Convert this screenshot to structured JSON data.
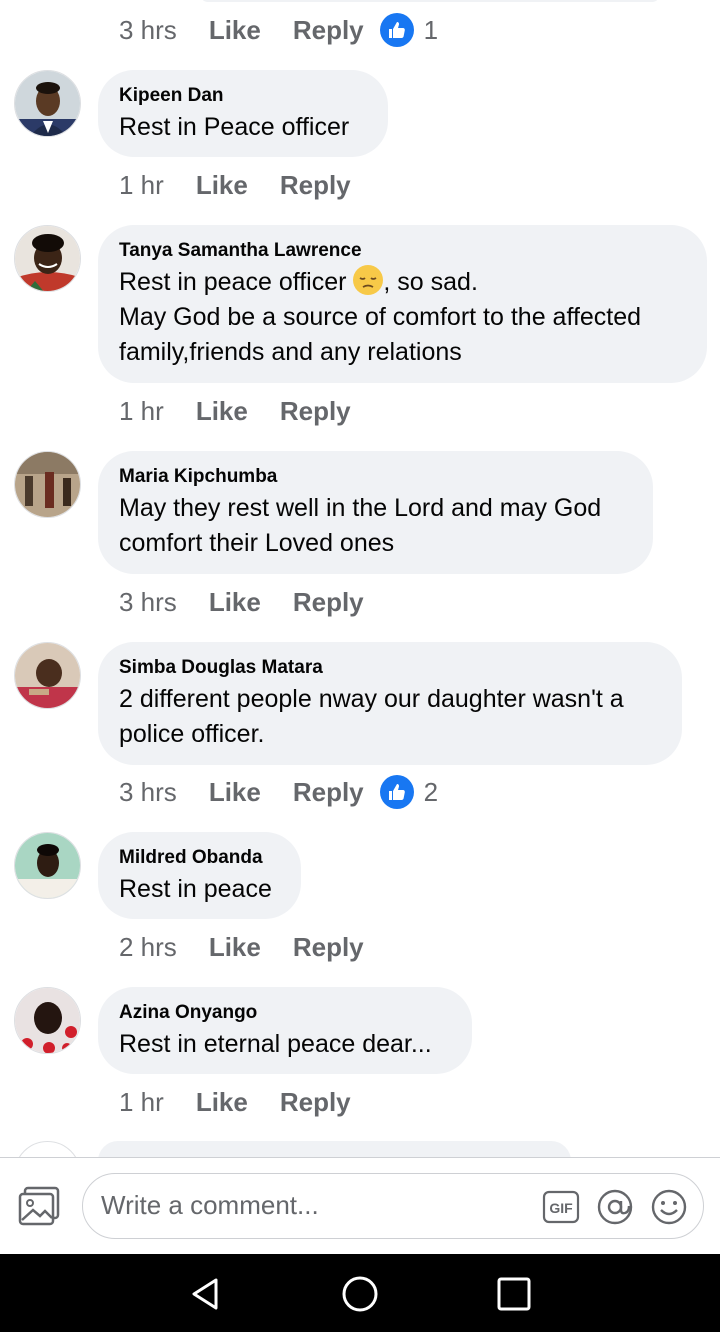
{
  "top": {
    "time": "3 hrs",
    "like": "Like",
    "reply": "Reply",
    "reactions": "1"
  },
  "comments": [
    {
      "name": "Kipeen Dan",
      "lines": [
        "Rest in Peace officer"
      ],
      "time": "1 hr",
      "like": "Like",
      "reply": "Reply"
    },
    {
      "name": "Tanya Samantha Lawrence",
      "line1_a": "Rest in peace officer ",
      "line1_emoji": "pensive-face",
      "line1_b": ", so sad.",
      "lines": [
        "May God be a source of comfort to the affected",
        "family,friends and any relations"
      ],
      "time": "1 hr",
      "like": "Like",
      "reply": "Reply"
    },
    {
      "name": "Maria Kipchumba",
      "lines": [
        "May they rest well in the Lord and may God",
        "comfort their Loved ones"
      ],
      "time": "3 hrs",
      "like": "Like",
      "reply": "Reply"
    },
    {
      "name": "Simba Douglas Matara",
      "lines": [
        "2 different people nway our daughter wasn't a",
        "police officer."
      ],
      "time": "3 hrs",
      "like": "Like",
      "reply": "Reply",
      "reactions": "2"
    },
    {
      "name": "Mildred Obanda",
      "lines": [
        "Rest in peace"
      ],
      "time": "2 hrs",
      "like": "Like",
      "reply": "Reply"
    },
    {
      "name": "Azina Onyango",
      "lines": [
        "Rest in eternal peace dear..."
      ],
      "time": "1 hr",
      "like": "Like",
      "reply": "Reply"
    }
  ],
  "composer": {
    "placeholder": "Write a comment..."
  },
  "colors": {
    "accent": "#1877f2",
    "bubble": "#f0f2f5",
    "meta": "#65676b"
  },
  "icons": {
    "photo": "photo-icon",
    "gif": "gif-icon",
    "mention": "at-icon",
    "emoji": "smile-icon",
    "back": "back-icon",
    "home": "home-icon",
    "recents": "recents-icon",
    "like": "thumbs-up-icon"
  }
}
